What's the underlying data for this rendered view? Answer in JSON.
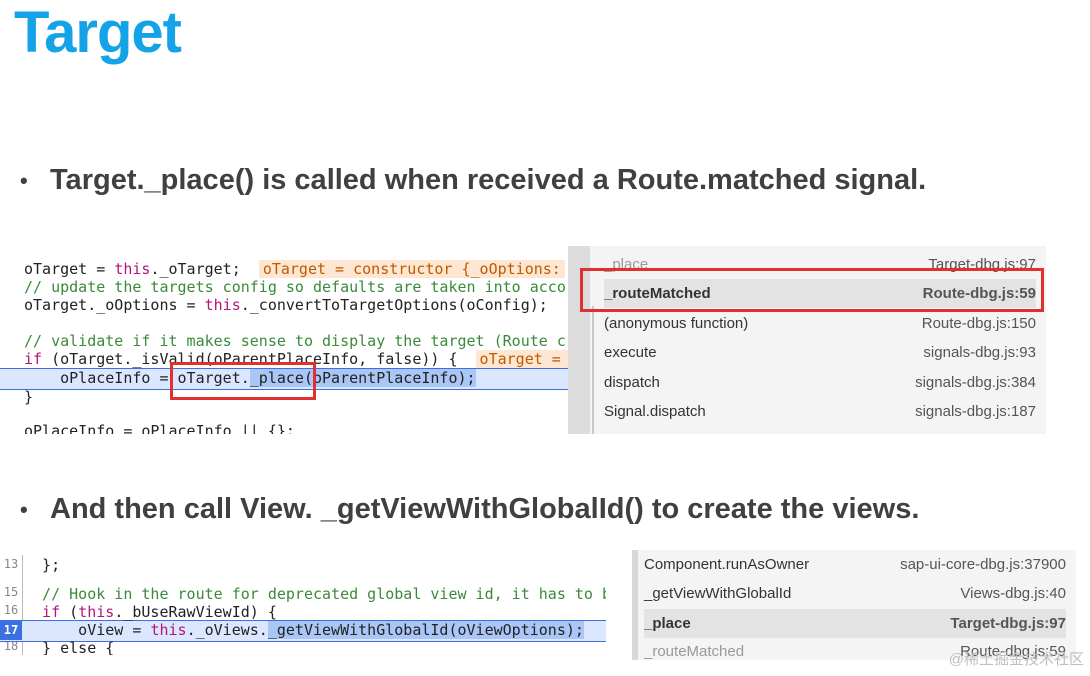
{
  "title": "Target",
  "bullets": [
    "Target._place() is called when received a Route.matched signal.",
    "And then call View. _getViewWithGlobalId() to create the views."
  ],
  "code1": {
    "l1a": "oTarget = ",
    "l1kw": "this",
    "l1b": "._oTarget;  ",
    "l1hint": "oTarget = constructor {_oOptions:",
    "l2": "// update the targets config so defaults are taken into acco",
    "l3a": "oTarget._oOptions = ",
    "l3kw": "this",
    "l3b": "._convertToTargetOptions(oConfig);",
    "l4": "// validate if it makes sense to display the target (Route c",
    "l5kw": "if",
    "l5a": " (oTarget._isValid(oParentPlaceInfo, false)) {  ",
    "l5hint": "oTarget = ",
    "l6a": "    oPlaceInfo = ",
    "l6b": "oTarget.",
    "l6sel": "_place(oParentPlaceInfo);",
    "l7": "}",
    "l8": "oPlaceInfo = oPlaceInfo || {};"
  },
  "stack1": [
    {
      "fn": "_place",
      "loc": "Target-dbg.js:97",
      "state": "faded"
    },
    {
      "fn": "_routeMatched",
      "loc": "Route-dbg.js:59",
      "state": "active"
    },
    {
      "fn": "(anonymous function)",
      "loc": "Route-dbg.js:150",
      "state": "normal"
    },
    {
      "fn": "execute",
      "loc": "signals-dbg.js:93",
      "state": "normal"
    },
    {
      "fn": "dispatch",
      "loc": "signals-dbg.js:384",
      "state": "normal"
    },
    {
      "fn": "Signal.dispatch",
      "loc": "signals-dbg.js:187",
      "state": "normal"
    }
  ],
  "code2": {
    "gutter": [
      "13",
      "15",
      "16",
      "17",
      "18"
    ],
    "l1": "  };",
    "l2": "  // Hook in the route for deprecated global view id, it has to be",
    "l3kw": "  if",
    "l3a": " (",
    "l3kw2": "this",
    "l3b": "._bUseRawViewId) {",
    "l4a": "      oView = ",
    "l4kw": "this",
    "l4b": "._oViews.",
    "l4sel": "_getViewWithGlobalId(oViewOptions);",
    "l5": "  } else {"
  },
  "stack2": [
    {
      "fn": "Component.runAsOwner",
      "loc": "sap-ui-core-dbg.js:37900",
      "state": "normal"
    },
    {
      "fn": "_getViewWithGlobalId",
      "loc": "Views-dbg.js:40",
      "state": "normal"
    },
    {
      "fn": "_place",
      "loc": "Target-dbg.js:97",
      "state": "active"
    },
    {
      "fn": "_routeMatched",
      "loc": "Route-dbg.js:59",
      "state": "faded"
    }
  ],
  "watermark": "@稀土掘金技术社区"
}
